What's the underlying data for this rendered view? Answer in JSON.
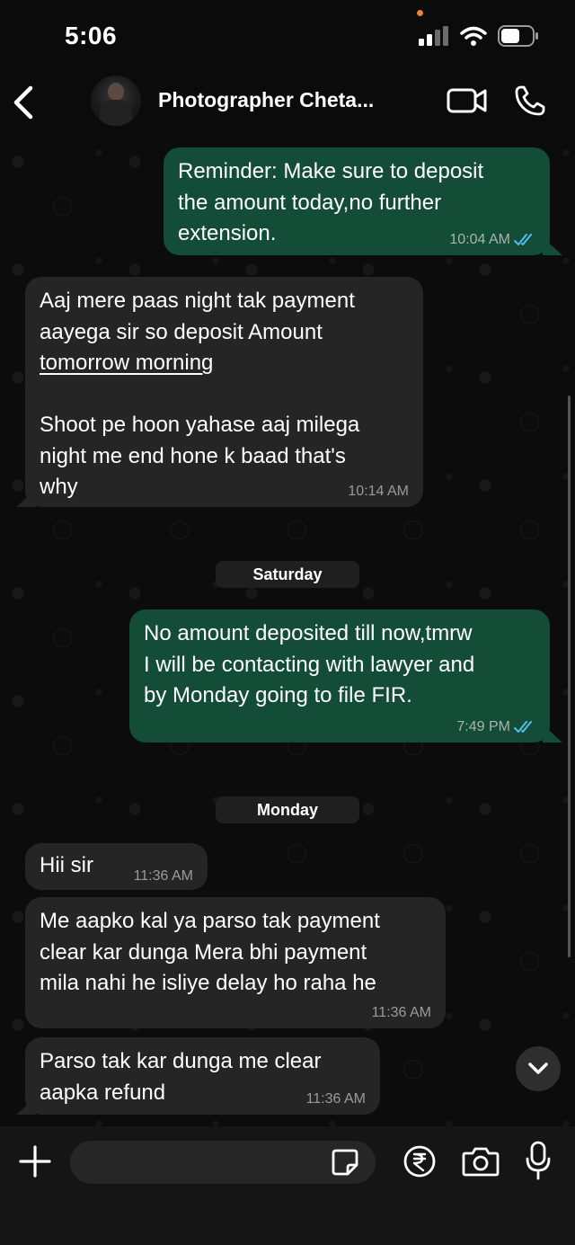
{
  "status_bar": {
    "time": "5:06",
    "icons": [
      "signal-icon",
      "wifi-icon",
      "battery-icon"
    ]
  },
  "header": {
    "contact_name": "Photographer Cheta...",
    "actions": [
      "back-icon",
      "video-call-icon",
      "voice-call-icon"
    ]
  },
  "messages": [
    {
      "direction": "out",
      "text": "Reminder: Make sure to deposit\nthe amount today,no further\nextension.",
      "time": "10:04 AM",
      "read": true
    },
    {
      "direction": "in",
      "text_line1": "Aaj mere paas night tak payment\naayega sir so deposit Amount",
      "text_link": "tomorrow morning",
      "text_line2": "Shoot pe hoon yahase aaj milega\nnight me end hone k baad that's\nwhy",
      "time": "10:14 AM"
    },
    {
      "direction": "out",
      "text": "No amount deposited till now,tmrw\nI will be contacting with lawyer and\nby Monday going to file FIR.",
      "time": "7:49 PM",
      "read": true
    },
    {
      "direction": "in",
      "text": "Hii sir",
      "time": "11:36 AM"
    },
    {
      "direction": "in",
      "text": "Me aapko kal ya parso tak payment\nclear kar dunga Mera bhi payment\nmila nahi he isliye delay ho raha he",
      "time": "11:36 AM"
    },
    {
      "direction": "in",
      "text": "Parso tak kar dunga me clear\naapka refund",
      "time": "11:36 AM"
    }
  ],
  "day_separators": [
    "Saturday",
    "Monday"
  ],
  "composer": {
    "input_value": "",
    "buttons": [
      "plus-icon",
      "sticker-icon",
      "rupee-icon",
      "camera-icon",
      "mic-icon"
    ]
  },
  "colors": {
    "outgoing_bubble": "#144d37",
    "incoming_bubble": "#252525",
    "read_ticks": "#53bdeb",
    "background": "#0c0c0c"
  }
}
